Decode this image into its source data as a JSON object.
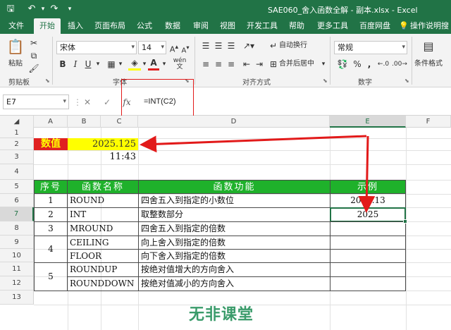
{
  "window": {
    "title": "SAE060_舍入函数全解 - 副本.xlsx  -  Excel"
  },
  "menu": {
    "tabs": [
      "文件",
      "开始",
      "插入",
      "页面布局",
      "公式",
      "数据",
      "审阅",
      "视图",
      "开发工具",
      "帮助",
      "更多工具",
      "百度网盘"
    ],
    "active_index": 1,
    "search_label": "操作说明搜"
  },
  "ribbon": {
    "paste_label": "粘贴",
    "clipboard_label": "剪贴板",
    "font_name": "宋体",
    "font_size": "14",
    "bold": "B",
    "italic": "I",
    "underline": "U",
    "wen": "wén",
    "font_group_label": "字体",
    "wrap_text": "自动换行",
    "merge_center": "合并后居中",
    "align_group_label": "对齐方式",
    "number_format": "常规",
    "number_group_label": "数字",
    "cond_format": "条件格式"
  },
  "formula_bar": {
    "name_box": "E7",
    "formula": "=INT(C2)"
  },
  "sheet": {
    "columns": [
      "A",
      "B",
      "C",
      "D",
      "E",
      "F"
    ],
    "selected_column": "E",
    "rows": [
      "1",
      "2",
      "3",
      "4",
      "5",
      "6",
      "7",
      "8",
      "9",
      "10",
      "11",
      "12",
      "13"
    ],
    "selected_row": "7",
    "c2_label": "数值",
    "c2_value": "2025.125",
    "c3_value": "11:43",
    "table": {
      "headers": [
        "序号",
        "函数名称",
        "函数功能",
        "示例"
      ],
      "rows": [
        {
          "no": "1",
          "name": "ROUND",
          "desc": "四舍五入到指定的小数位",
          "example": "2025.13"
        },
        {
          "no": "2",
          "name": "INT",
          "desc": "取整数部分",
          "example": "2025"
        },
        {
          "no": "3",
          "name": "MROUND",
          "desc": "四舍五入到指定的倍数",
          "example": ""
        },
        {
          "no": "4",
          "name": "CEILING",
          "desc": "向上舍入到指定的倍数",
          "example": ""
        },
        {
          "no": "",
          "name": "FLOOR",
          "desc": "向下舍入到指定的倍数",
          "example": ""
        },
        {
          "no": "5",
          "name": "ROUNDUP",
          "desc": "按绝对值增大的方向舍入",
          "example": ""
        },
        {
          "no": "",
          "name": "ROUNDDOWN",
          "desc": "按绝对值减小的方向舍入",
          "example": ""
        }
      ]
    }
  },
  "watermark": "无非课堂",
  "colors": {
    "excel_green": "#217346",
    "header_green": "#1fb12b",
    "label_red": "#e02020",
    "value_yellow": "#ffff00",
    "annotation_red": "#e21a1a"
  }
}
